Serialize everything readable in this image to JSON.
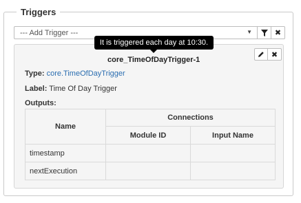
{
  "fieldset": {
    "legend": "Triggers"
  },
  "add_trigger": {
    "selected": "--- Add Trigger ---",
    "caret_icon": "caret-down-icon",
    "filter_icon": "filter-icon",
    "clear_icon": "close-icon"
  },
  "tooltip": {
    "text": "It is triggered each day at 10:30."
  },
  "trigger": {
    "title": "core_TimeOfDayTrigger-1",
    "edit_icon": "pencil-icon",
    "remove_icon": "close-icon",
    "type_label": "Type:",
    "type_value": "core.TimeOfDayTrigger",
    "label_label": "Label:",
    "label_value": "Time Of Day Trigger",
    "outputs_label": "Outputs:"
  },
  "outputs_table": {
    "col_name": "Name",
    "col_connections": "Connections",
    "col_module_id": "Module ID",
    "col_input_name": "Input Name",
    "rows": [
      {
        "name": "timestamp",
        "module_id": "",
        "input_name": ""
      },
      {
        "name": "nextExecution",
        "module_id": "",
        "input_name": ""
      }
    ]
  },
  "colors": {
    "link": "#2a6db0",
    "tooltip_bg": "#000000",
    "panel_bg": "#f5f5f5"
  }
}
